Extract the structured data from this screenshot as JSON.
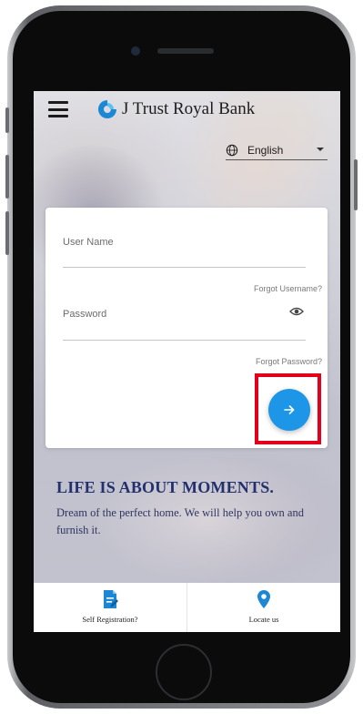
{
  "header": {
    "brand_name": "J Trust Royal Bank",
    "language": "English"
  },
  "login": {
    "username_label": "User Name",
    "forgot_username": "Forgot Username?",
    "password_label": "Password",
    "forgot_password": "Forgot Password?"
  },
  "promo": {
    "headline": "LIFE IS ABOUT MOMENTS.",
    "subtext": "Dream of the perfect home. We will help you own and furnish it."
  },
  "bottom_nav": {
    "self_registration": "Self Registration?",
    "locate_us": "Locate us"
  },
  "colors": {
    "accent": "#1e96e8",
    "highlight": "#e2001a",
    "headline": "#22306e"
  },
  "icons": [
    "menu-icon",
    "bank-logo-icon",
    "globe-icon",
    "eye-icon",
    "arrow-right-icon",
    "registration-icon",
    "location-pin-icon"
  ]
}
